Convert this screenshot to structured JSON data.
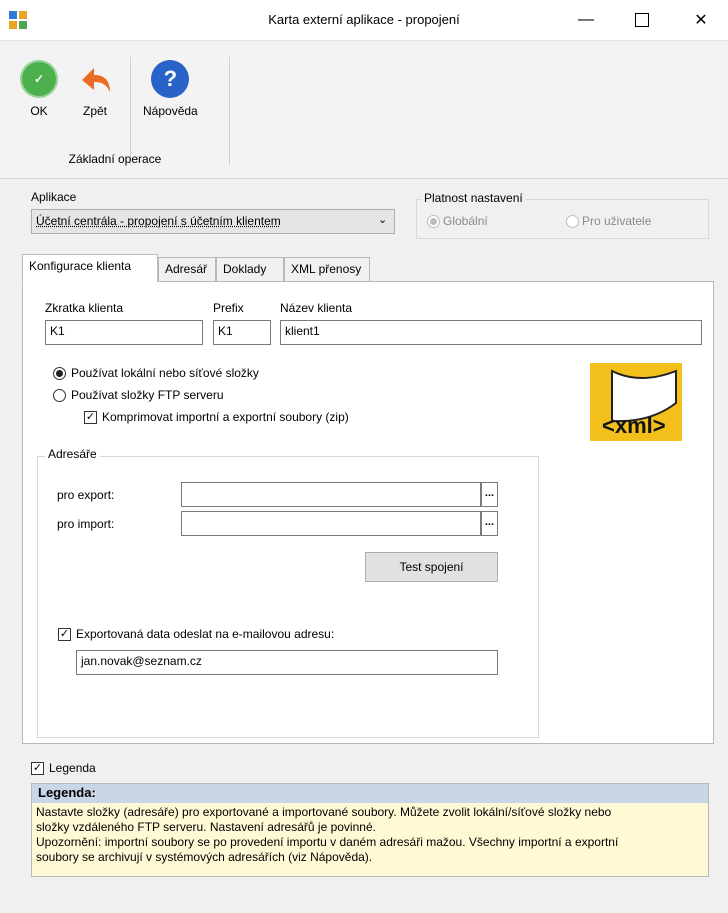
{
  "window": {
    "title": "Karta externí aplikace - propojení",
    "min_icon": "minimize-icon",
    "max_icon": "maximize-icon",
    "close_icon": "close-icon"
  },
  "ribbon": {
    "ok_label": "OK",
    "back_label": "Zpět",
    "help_label": "Nápověda",
    "group_label": "Základní operace"
  },
  "app": {
    "label": "Aplikace",
    "selected": "Účetní centrála - propojení s účetním klientem"
  },
  "validity": {
    "label": "Platnost nastavení",
    "options": [
      "Globální",
      "Pro uživatele"
    ]
  },
  "tabs": [
    "Konfigurace klienta",
    "Adresář",
    "Doklady",
    "XML přenosy"
  ],
  "client": {
    "abbr_label": "Zkratka klienta",
    "abbr_value": "K1",
    "prefix_label": "Prefix",
    "prefix_value": "K1",
    "name_label": "Název klienta",
    "name_value": "klient1"
  },
  "mode": {
    "local_label": "Používat lokální nebo síťové složky",
    "ftp_label": "Používat složky FTP serveru",
    "zip_label": "Komprimovat importní a exportní soubory (zip)"
  },
  "logo_text": "<xml>",
  "dirs": {
    "group_label": "Adresáře",
    "export_label": "pro export:",
    "export_value": "",
    "import_label": "pro import:",
    "import_value": "",
    "browse_label": "...",
    "test_label": "Test spojení",
    "email_check_label": "Exportovaná data odeslat na e-mailovou adresu:",
    "email_value": "jan.novak@seznam.cz"
  },
  "legend": {
    "check_label": "Legenda",
    "title": "Legenda:",
    "line1": "Nastavte složky (adresáře) pro exportované a importované soubory. Můžete zvolit lokální/síťové složky nebo",
    "line2": "složky vzdáleného FTP serveru. Nastavení adresářů je povinné.",
    "line3": "Upozornění: importní soubory se po provedení importu v daném adresáři mažou. Všechny importní a exportní",
    "line4": "soubory se archivují v systémových adresářích (viz Nápověda)."
  }
}
